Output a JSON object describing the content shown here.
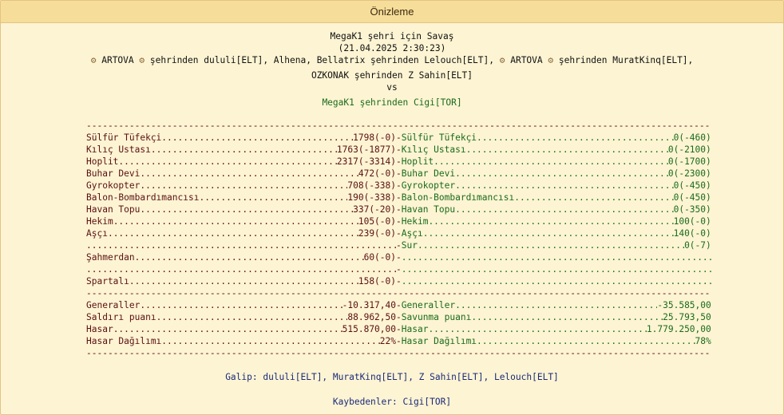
{
  "window": {
    "title": "Önizleme"
  },
  "battle": {
    "title": "MegaK1 şehri için Savaş",
    "datetime": "(21.04.2025 2:30:23)",
    "attackers_line1_parts": [
      {
        "gear": true,
        "text": "ARTOVA"
      },
      {
        "gear": true,
        "text": "şehrinden dululi[ELT], Alhena, Bellatrix şehrinden Lelouch[ELT],"
      },
      {
        "gear": true,
        "text": "ARTOVA"
      },
      {
        "gear": true,
        "text": "şehrinden MuratKinq[ELT],"
      }
    ],
    "attackers_line2": "OZKONAK şehrinden Z Sahin[ELT]",
    "vs": "vs",
    "defender": "MegaK1 şehrinden Cigi[TOR]"
  },
  "units": [
    {
      "att_name": "Sülfür Tüfekçi",
      "att_val": "1798(-0)",
      "def_name": "Sülfür Tüfekçi",
      "def_val": "0(-460)"
    },
    {
      "att_name": "Kılıç Ustası",
      "att_val": "1763(-1877)",
      "def_name": "Kılıç Ustası",
      "def_val": "0(-2100)"
    },
    {
      "att_name": "Hoplit",
      "att_val": "2317(-3314)",
      "def_name": "Hoplit",
      "def_val": "0(-1700)"
    },
    {
      "att_name": "Buhar Devi",
      "att_val": "472(-0)",
      "def_name": "Buhar Devi",
      "def_val": "0(-2300)"
    },
    {
      "att_name": "Gyrokopter",
      "att_val": "708(-338)",
      "def_name": "Gyrokopter",
      "def_val": "0(-450)"
    },
    {
      "att_name": "Balon-Bombardımancısı",
      "att_val": "190(-338)",
      "def_name": "Balon-Bombardımancısı",
      "def_val": "0(-450)"
    },
    {
      "att_name": "Havan Topu",
      "att_val": "337(-20)",
      "def_name": "Havan Topu",
      "def_val": "0(-350)"
    },
    {
      "att_name": "Hekim",
      "att_val": "105(-0)",
      "def_name": "Hekim",
      "def_val": "100(-0)"
    },
    {
      "att_name": "Aşçı",
      "att_val": "239(-0)",
      "def_name": "Aşçı",
      "def_val": "140(-0)"
    },
    {
      "att_name": "",
      "att_val": "",
      "def_name": "Sur",
      "def_val": "0(-7)"
    },
    {
      "att_name": "Şahmerdan",
      "att_val": "60(-0)",
      "def_name": "",
      "def_val": ""
    },
    {
      "att_name": "",
      "att_val": "",
      "def_name": "",
      "def_val": ""
    },
    {
      "att_name": "Spartalı",
      "att_val": "158(-0)",
      "def_name": "",
      "def_val": ""
    }
  ],
  "stats": [
    {
      "att_name": "Generaller",
      "att_val": "-10.317,40",
      "def_name": "Generaller",
      "def_val": "-35.585,00"
    },
    {
      "att_name": "Saldırı puanı",
      "att_val": "88.962,50",
      "def_name": "Savunma puanı",
      "def_val": "25.793,50"
    },
    {
      "att_name": "Hasar",
      "att_val": "515.870,00",
      "def_name": "Hasar",
      "def_val": "1.779.250,00"
    },
    {
      "att_name": "Hasar Dağılımı",
      "att_val": "22%",
      "def_name": "Hasar Dağılımı",
      "def_val": "78%"
    }
  ],
  "result": {
    "winner": "Galip: dululi[ELT], MuratKinq[ELT], Z Sahin[ELT], Lelouch[ELT]",
    "loser": "Kaybedenler: Cigi[TOR]"
  },
  "icons": {
    "gear": "gear-icon"
  }
}
